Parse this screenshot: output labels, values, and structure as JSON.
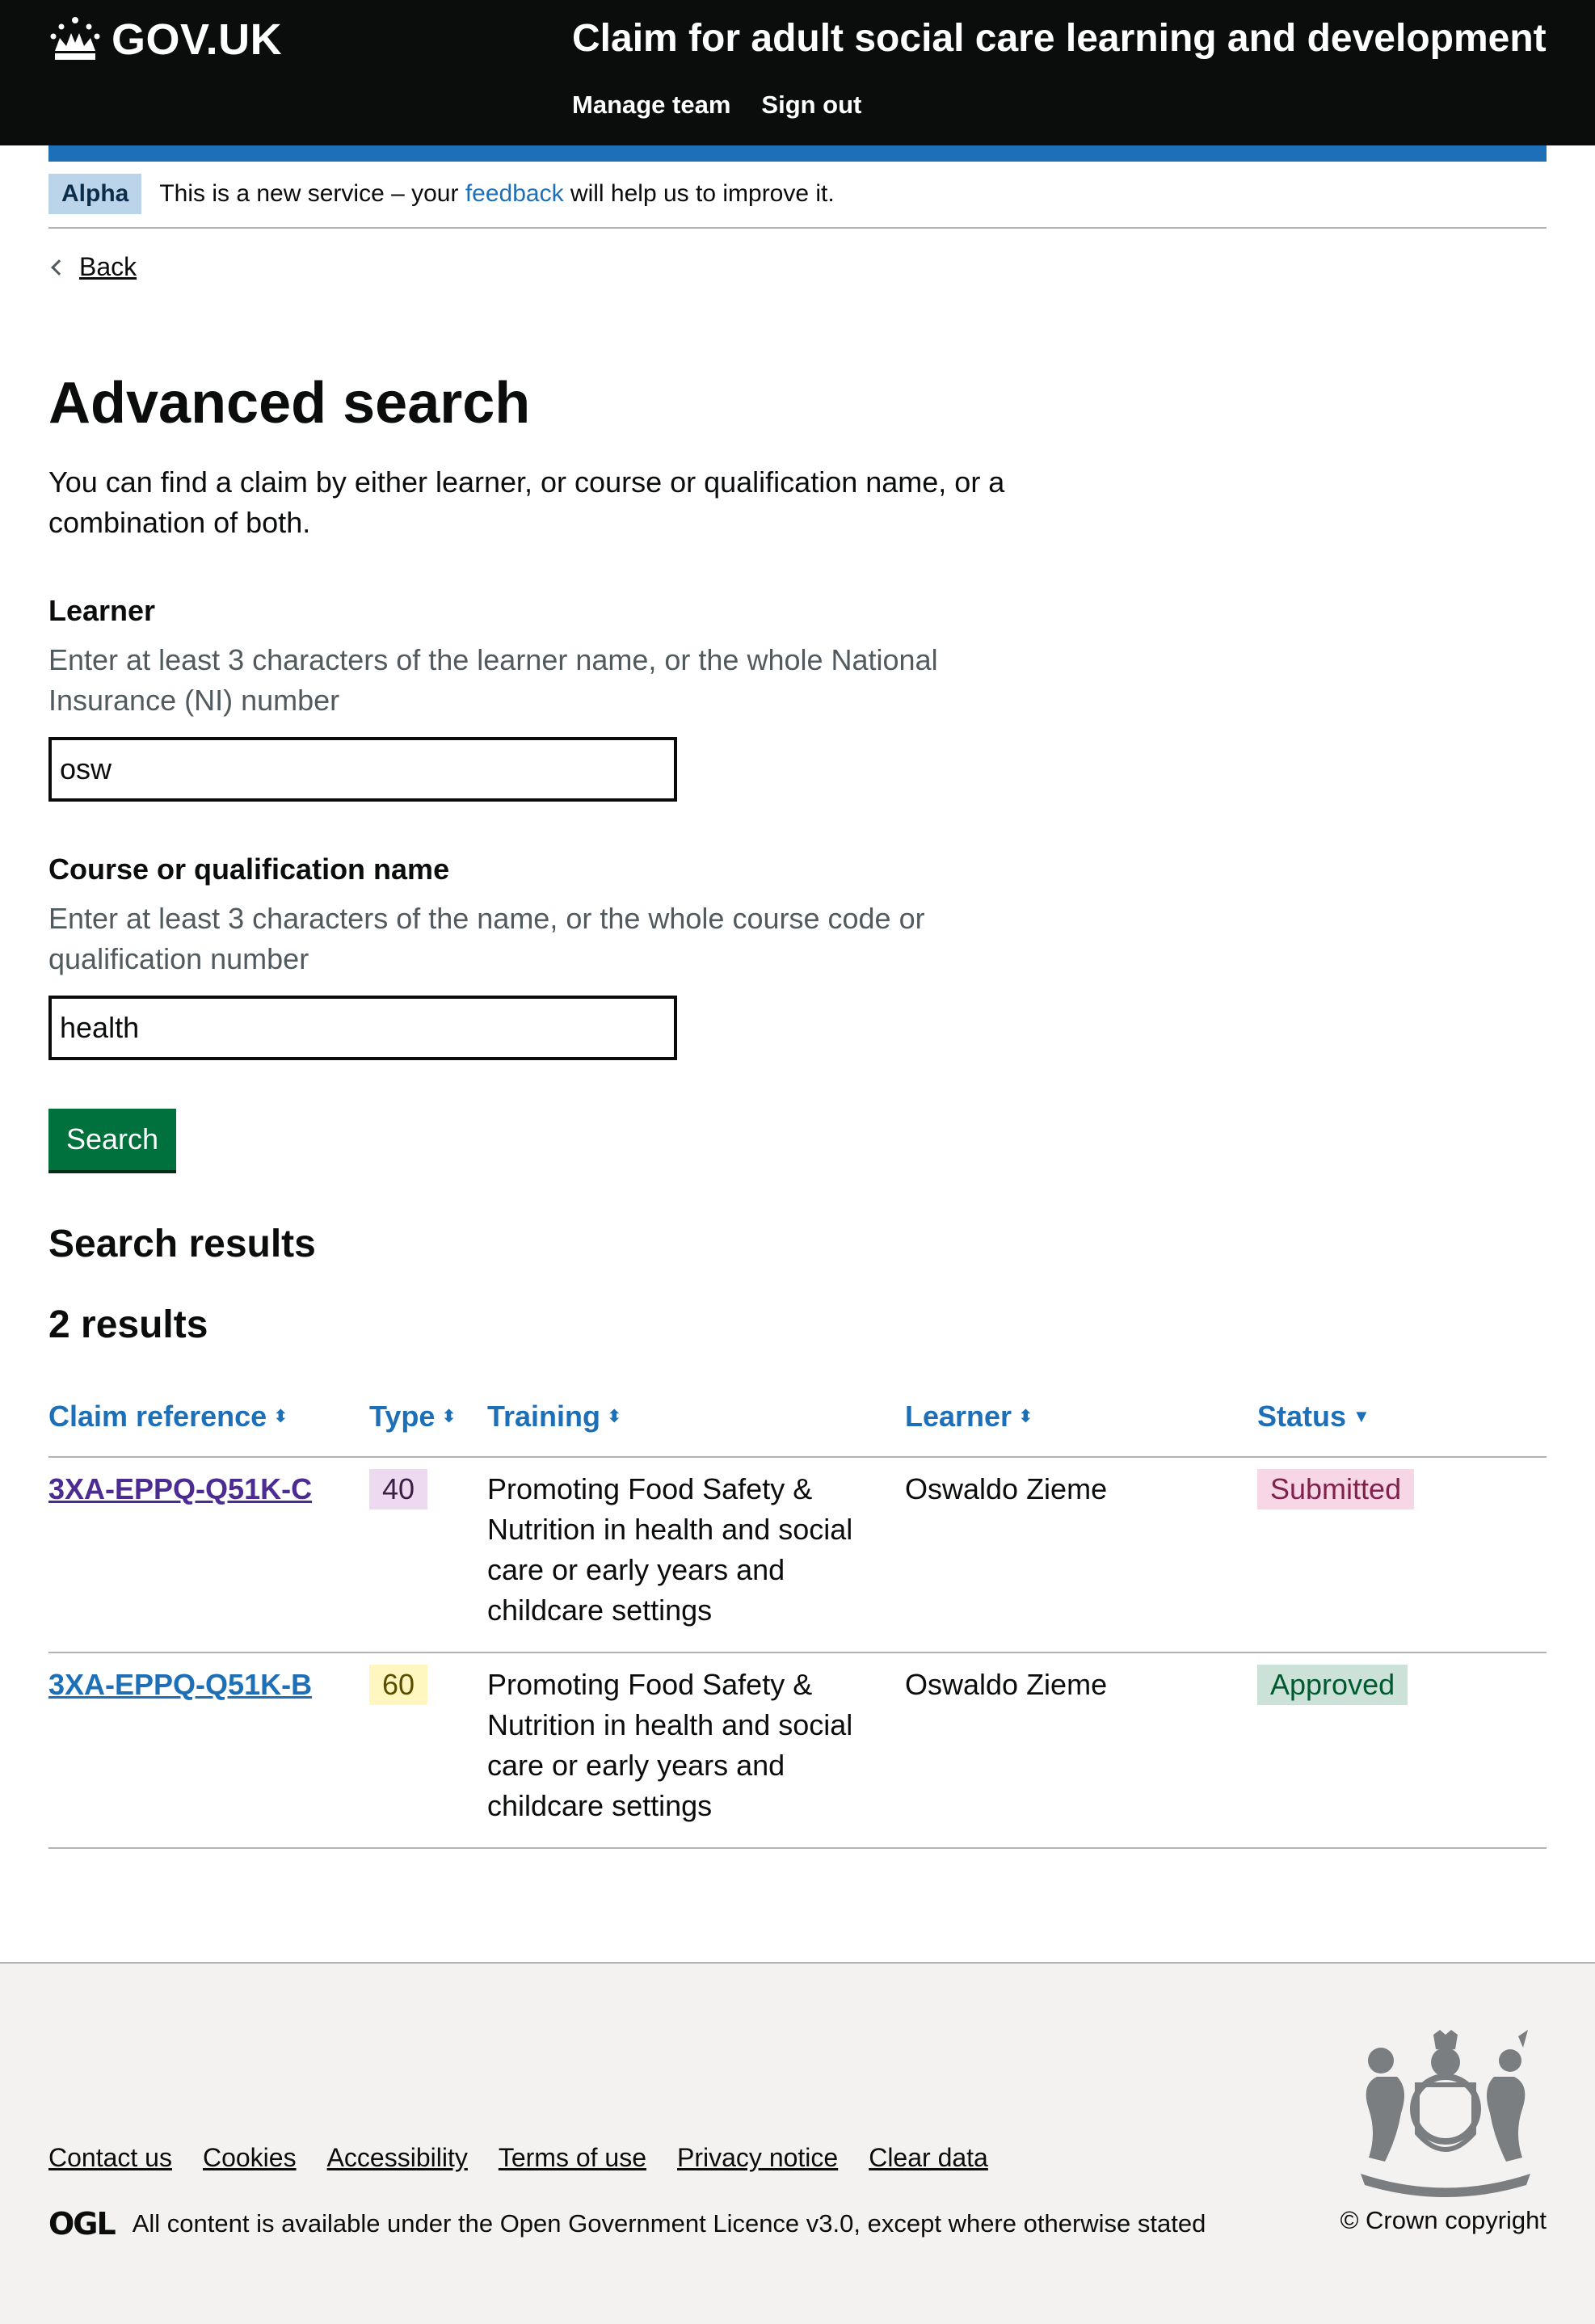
{
  "header": {
    "logo_text": "GOV.UK",
    "service_name": "Claim for adult social care learning and development",
    "nav": [
      "Manage team",
      "Sign out"
    ]
  },
  "phase_banner": {
    "tag": "Alpha",
    "text_before": "This is a new service – your ",
    "link": "feedback",
    "text_after": " will help us to improve it."
  },
  "back_link": "Back",
  "page": {
    "title": "Advanced search",
    "lead": "You can find a claim by either learner, or course or qualification name, or a combination of both."
  },
  "form": {
    "learner": {
      "label": "Learner",
      "hint": "Enter at least 3 characters of the learner name, or the whole National Insurance (NI) number",
      "value": "osw"
    },
    "course": {
      "label": "Course or qualification name",
      "hint": "Enter at least 3 characters of the name, or the whole course code or qualification number",
      "value": "health"
    },
    "search_button": "Search"
  },
  "results": {
    "heading": "Search results",
    "count": "2 results",
    "columns": [
      "Claim reference",
      "Type",
      "Training",
      "Learner",
      "Status"
    ],
    "sort_icons": [
      "⬍",
      "⬍",
      "⬍",
      "⬍",
      "▼"
    ],
    "rows": [
      {
        "reference": "3XA-EPPQ-Q51K-C",
        "type": "40",
        "training": "Promoting Food Safety & Nutrition in health and social care or early years and childcare settings",
        "learner": "Oswaldo Zieme",
        "status": "Submitted",
        "status_color": "#f7d7e6"
      },
      {
        "reference": "3XA-EPPQ-Q51K-B",
        "type": "60",
        "training": "Promoting Food Safety & Nutrition in health and social care or early years and childcare settings",
        "learner": "Oswaldo Zieme",
        "status": "Approved",
        "status_color": "#cce2d8"
      }
    ]
  },
  "footer": {
    "links": [
      "Contact us",
      "Cookies",
      "Accessibility",
      "Terms of use",
      "Privacy notice",
      "Clear data"
    ],
    "ogl_logo": "OGL",
    "licence_before": "All content is available under the ",
    "licence_link": "Open Government Licence v3.0",
    "licence_after": ", except where otherwise stated",
    "copyright": "© Crown copyright"
  },
  "colors": {
    "header_bg": "#0b0c0c",
    "brand_blue": "#1d70b8",
    "button_green": "#00703c",
    "visited_link": "#4c2c92",
    "footer_bg": "#f3f2f1"
  }
}
